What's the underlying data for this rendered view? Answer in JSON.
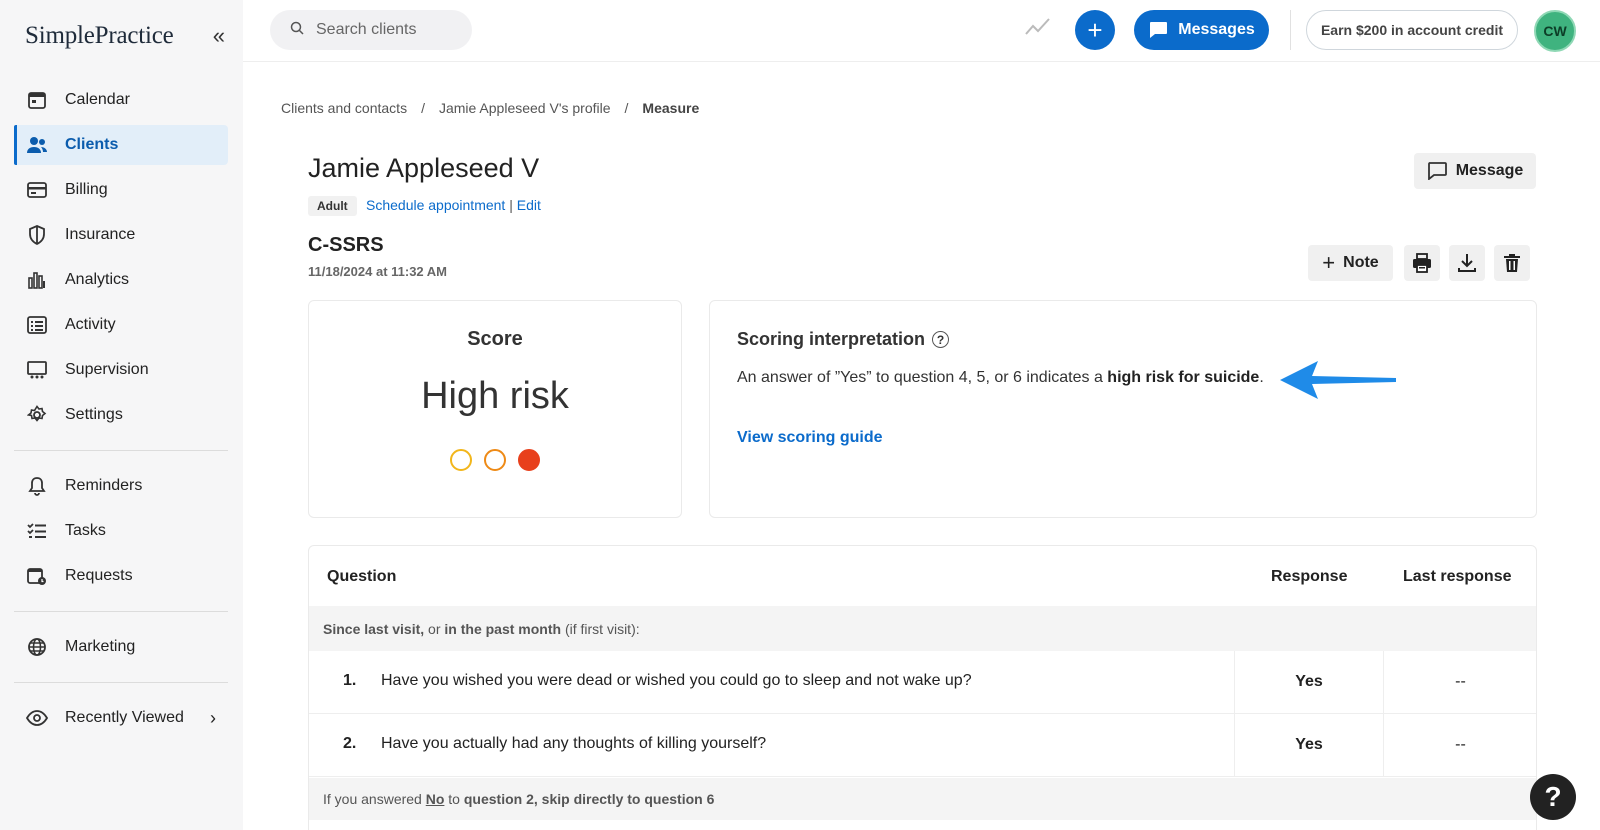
{
  "brand": {
    "logo": "SimplePractice"
  },
  "sidebar": {
    "items": [
      {
        "label": "Calendar",
        "icon": "calendar-icon"
      },
      {
        "label": "Clients",
        "icon": "users-icon",
        "active": true
      },
      {
        "label": "Billing",
        "icon": "credit-card-icon"
      },
      {
        "label": "Insurance",
        "icon": "shield-icon"
      },
      {
        "label": "Analytics",
        "icon": "bar-chart-icon"
      },
      {
        "label": "Activity",
        "icon": "list-icon"
      },
      {
        "label": "Supervision",
        "icon": "supervision-icon"
      },
      {
        "label": "Settings",
        "icon": "gear-icon"
      }
    ],
    "items2": [
      {
        "label": "Reminders",
        "icon": "bell-icon"
      },
      {
        "label": "Tasks",
        "icon": "checklist-icon"
      },
      {
        "label": "Requests",
        "icon": "calendar-request-icon"
      }
    ],
    "marketing": "Marketing",
    "recent": "Recently Viewed"
  },
  "topbar": {
    "search_placeholder": "Search clients",
    "messages": "Messages",
    "earn": "Earn $200 in account credit",
    "avatar": "CW",
    "accent": "#0b6bcb"
  },
  "breadcrumb": [
    "Clients and contacts",
    "Jamie Appleseed V's profile",
    "Measure"
  ],
  "client": {
    "name": "Jamie Appleseed V",
    "tag": "Adult",
    "schedule": "Schedule appointment",
    "edit": "Edit",
    "message": "Message"
  },
  "measure": {
    "title": "C-SSRS",
    "date": "11/18/2024 at 11:32 AM",
    "note": "Note"
  },
  "score": {
    "label": "Score",
    "value": "High risk",
    "dots": [
      {
        "color": "#f2b61b",
        "filled": false
      },
      {
        "color": "#ee8a16",
        "filled": false
      },
      {
        "color": "#e8401c",
        "filled": true
      }
    ]
  },
  "interpretation": {
    "title": "Scoring interpretation",
    "text_before": "An answer of ”Yes” to question 4, 5, or 6 indicates a ",
    "text_bold": "high risk for suicide",
    "text_after": ".",
    "guide": "View scoring guide"
  },
  "table": {
    "headers": {
      "question": "Question",
      "response": "Response",
      "last": "Last response"
    },
    "section1": {
      "b1": "Since last visit,",
      "t1": " or ",
      "b2": "in the past month",
      "t2": " (if first visit):"
    },
    "rows": [
      {
        "num": "1.",
        "text": "Have you wished you were dead or wished you could go to sleep and not wake up?",
        "response": "Yes",
        "last": "--"
      },
      {
        "num": "2.",
        "text": "Have you actually had any thoughts of killing yourself?",
        "response": "Yes",
        "last": "--"
      }
    ],
    "section2": {
      "t1": "If you answered ",
      "u": "No",
      "t2": " to ",
      "b": "question 2, skip directly to question 6"
    }
  },
  "help": "?"
}
